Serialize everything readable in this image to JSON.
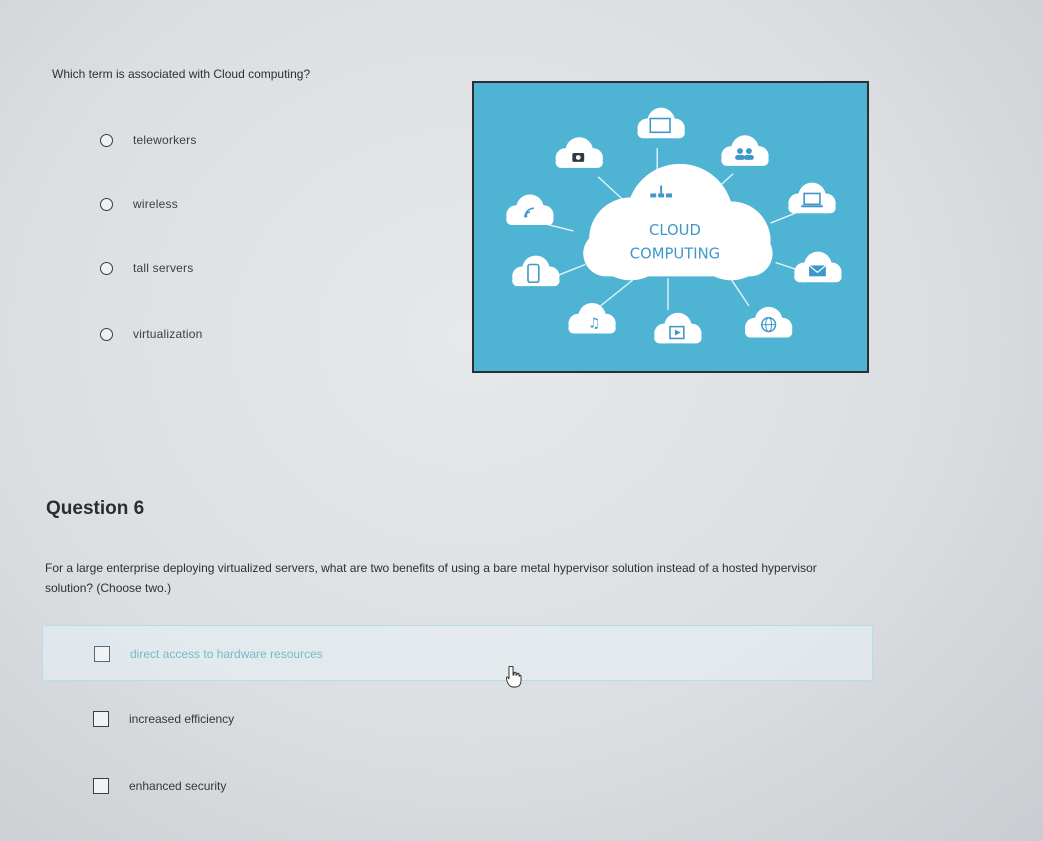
{
  "question5": {
    "prompt": "Which term is associated with Cloud computing?",
    "options": [
      {
        "label": "teleworkers"
      },
      {
        "label": "wireless"
      },
      {
        "label": "tall servers"
      },
      {
        "label": "virtualization"
      }
    ]
  },
  "illustration": {
    "line1": "CLOUD",
    "line2": "COMPUTING",
    "background_color": "#4fb3d4"
  },
  "question6": {
    "heading": "Question 6",
    "prompt": "For a large enterprise deploying virtualized servers, what are two benefits of using a bare metal hypervisor solution instead of a hosted hypervisor solution? (Choose two.)",
    "options": [
      {
        "label": "direct access to hardware resources"
      },
      {
        "label": "increased efficiency"
      },
      {
        "label": "enhanced security"
      }
    ]
  },
  "colors": {
    "highlight_text": "#79b8c9",
    "text": "#2c2f35"
  }
}
